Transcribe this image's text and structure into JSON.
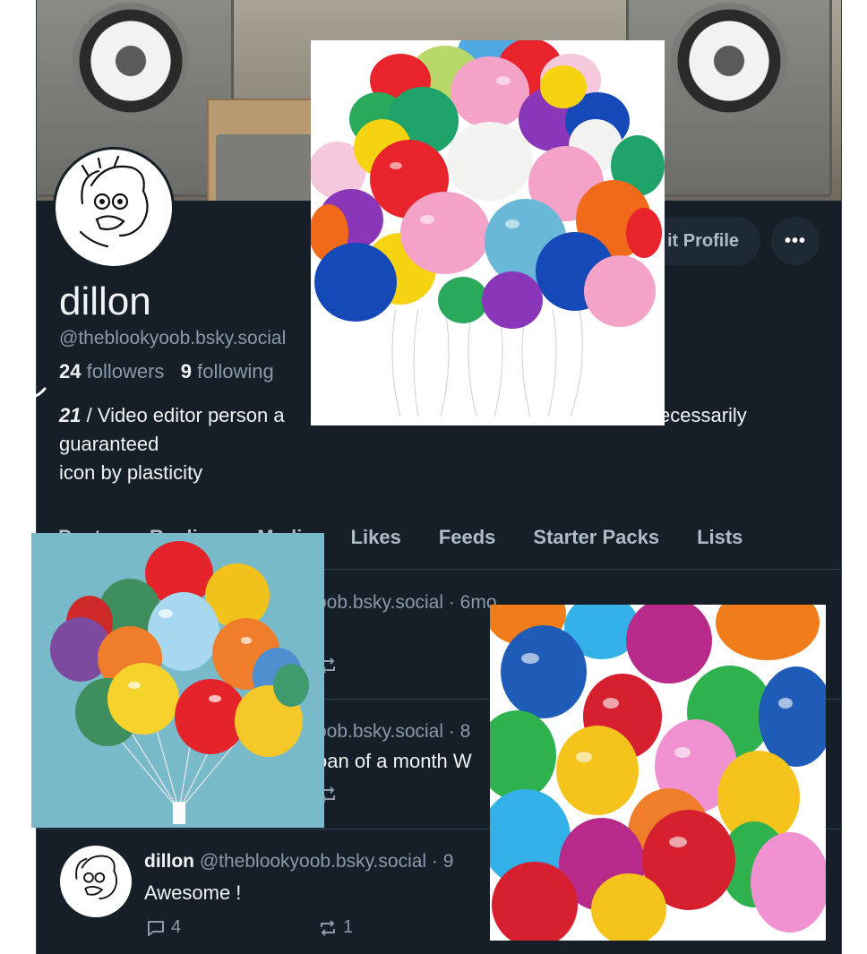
{
  "profile": {
    "name": "dillon",
    "handle": "@theblookyoob.bsky.social",
    "followers_count": "24",
    "followers_label": "followers",
    "following_count": "9",
    "following_label": "following",
    "bio_line1_prefix": "21",
    "bio_line1": " / Video editor person a",
    "bio_line1_tail": "ecessarily",
    "bio_line2": "guaranteed",
    "bio_line3": "icon by plasticity"
  },
  "actions": {
    "edit_label": "it Profile",
    "more_label": "•••"
  },
  "tabs": [
    "Posts",
    "Replies",
    "Media",
    "Likes",
    "Feeds",
    "Starter Packs",
    "Lists"
  ],
  "tabs_visible": [
    "ia",
    "Likes",
    "Feeds",
    "Starter Packs",
    "Lists"
  ],
  "posts": [
    {
      "meta": "oob.bsky.social · 6mo",
      "text": ""
    },
    {
      "meta": "oob.bsky.social · 8",
      "text": "oan of a month W"
    },
    {
      "author": "dillon",
      "meta": "@theblookyoob.bsky.social · 9",
      "text": "Awesome !",
      "replies": "4",
      "reposts": "1"
    }
  ],
  "colors": {
    "background": "#161e27",
    "border": "#2e4052",
    "text": "#f1f3f5",
    "muted": "#8a99ab",
    "button_bg": "#1e2936"
  }
}
